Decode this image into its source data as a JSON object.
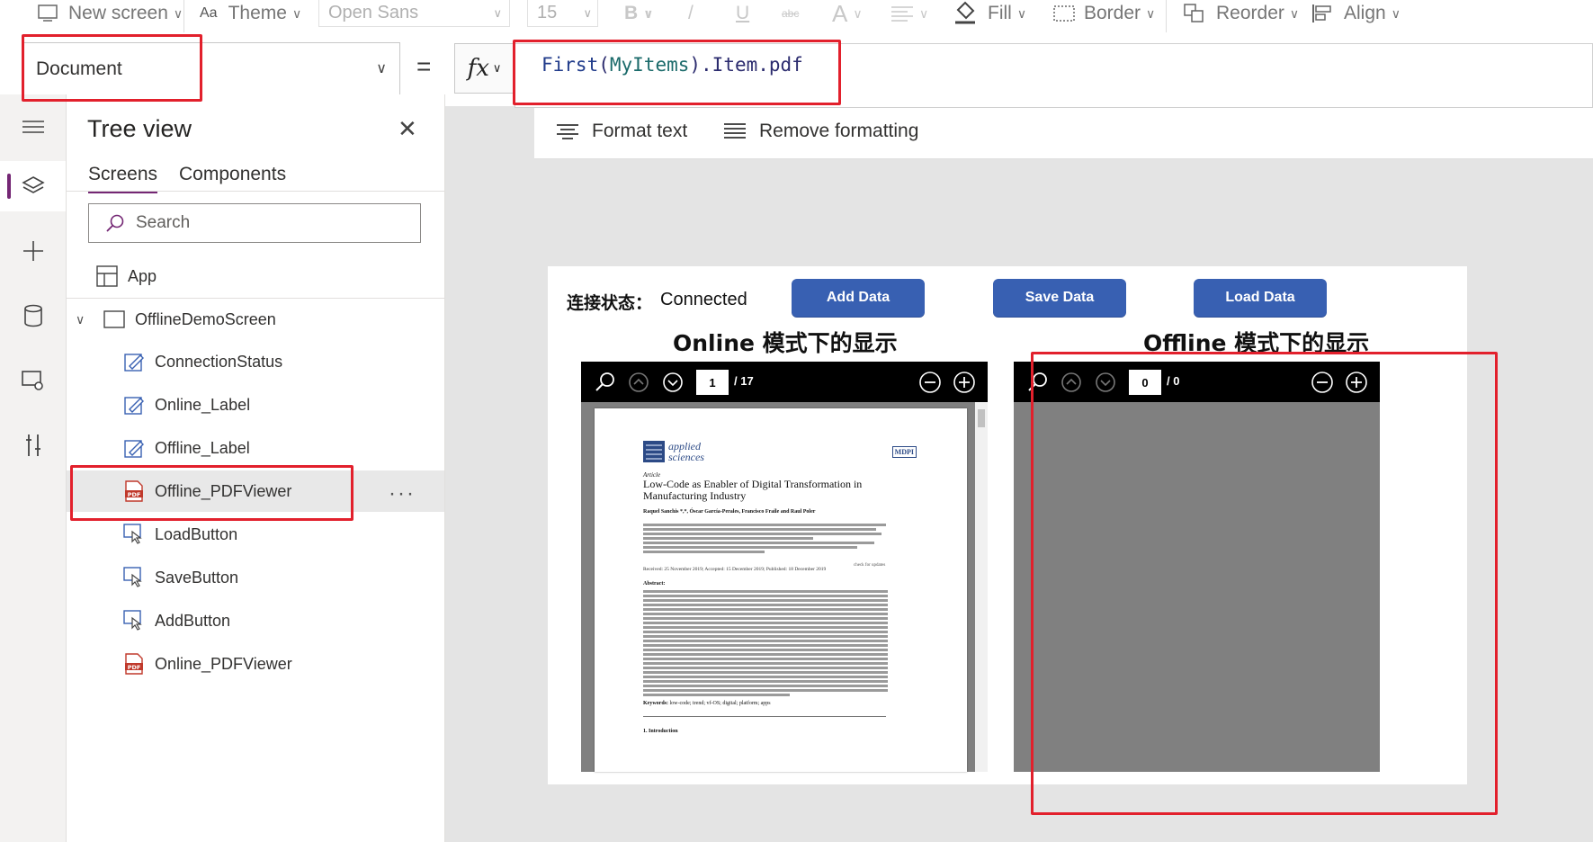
{
  "toolbar": {
    "new_screen": "New screen",
    "theme": "Theme",
    "font": "Open Sans",
    "font_size": "15",
    "bold": "B",
    "italic": "/",
    "underline": "U",
    "strikethrough": "abc",
    "font_color": "A",
    "fill": "Fill",
    "border": "Border",
    "reorder": "Reorder",
    "align": "Align"
  },
  "formula": {
    "property": "Document",
    "equals": "=",
    "fx": "fx",
    "fn_name": "First",
    "open_paren": "(",
    "collection": "MyItems",
    "rest": ").Item.pdf",
    "format_text": "Format text",
    "remove_formatting": "Remove formatting"
  },
  "tree": {
    "title": "Tree view",
    "tab_screens": "Screens",
    "tab_components": "Components",
    "search_placeholder": "Search",
    "app_label": "App",
    "screen_label": "OfflineDemoScreen",
    "items": [
      {
        "label": "ConnectionStatus",
        "icon": "edit-label-icon"
      },
      {
        "label": "Online_Label",
        "icon": "edit-label-icon"
      },
      {
        "label": "Offline_Label",
        "icon": "edit-label-icon"
      },
      {
        "label": "Offline_PDFViewer",
        "icon": "pdf-icon"
      },
      {
        "label": "LoadButton",
        "icon": "button-icon"
      },
      {
        "label": "SaveButton",
        "icon": "button-icon"
      },
      {
        "label": "AddButton",
        "icon": "button-icon"
      },
      {
        "label": "Online_PDFViewer",
        "icon": "pdf-icon"
      }
    ],
    "more": "···"
  },
  "canvas": {
    "conn_label": "连接状态：",
    "conn_value": "Connected",
    "add_data": "Add Data",
    "save_data": "Save Data",
    "load_data": "Load Data",
    "online_title": "Online 模式下的显示",
    "offline_title": "Offline 模式下的显示",
    "online_page": "1",
    "online_total": "/ 17",
    "offline_page": "0",
    "offline_total": "/ 0"
  },
  "doc": {
    "journal": "applied sciences",
    "publisher": "MDPI",
    "type": "Article",
    "title": "Low-Code as Enabler of Digital Transformation in Manufacturing Industry",
    "authors": "Raquel Sanchis *,*, Óscar García-Perales, Francisco Fraile and Raul Poler",
    "dates": "Received: 25 November 2019; Accepted: 15 December 2019; Published: 18 December 2019",
    "abstract_label": "Abstract:",
    "keywords_label": "Keywords:",
    "keywords": "low-code; trend; vf-OS; digital; platform; apps",
    "intro": "1. Introduction",
    "check": "check for updates"
  },
  "colors": {
    "accent": "#742774",
    "button": "#3860b2",
    "highlight": "#e2202c"
  }
}
